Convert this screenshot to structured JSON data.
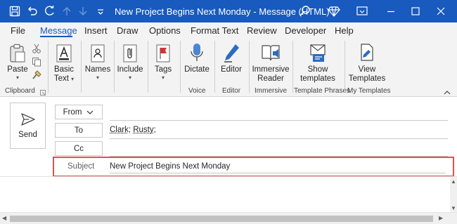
{
  "window": {
    "title": "New Project Begins Next Monday  -  Message (HTML)",
    "accent_color": "#185abd",
    "highlight_color": "#e0524b"
  },
  "titlebar_icons": [
    "save-icon",
    "undo-icon",
    "redo-icon",
    "up-arrow-icon",
    "down-arrow-icon",
    "customize-qat-icon",
    "search-icon",
    "diamond-icon",
    "restore-icon",
    "minimize-icon",
    "maximize-icon",
    "close-icon"
  ],
  "menu": {
    "tabs": [
      "File",
      "Message",
      "Insert",
      "Draw",
      "Options",
      "Format Text",
      "Review",
      "Developer",
      "Help"
    ],
    "active": "Message"
  },
  "ribbon": {
    "paste": "Paste",
    "basic_text": [
      "Basic",
      "Text"
    ],
    "names": "Names",
    "include": "Include",
    "tags": "Tags",
    "dictate": "Dictate",
    "editor": "Editor",
    "immersive_reader": [
      "Immersive",
      "Reader"
    ],
    "show_templates": [
      "Show",
      "templates"
    ],
    "view_templates": [
      "View",
      "Templates"
    ],
    "groups": [
      "Clipboard",
      "Voice",
      "Editor",
      "Immersive",
      "Template Phrases",
      "My Templates"
    ]
  },
  "compose": {
    "send": "Send",
    "from_label": "From",
    "to_label": "To",
    "to_value": [
      "Clark",
      "Rusty"
    ],
    "cc_label": "Cc",
    "subject_label": "Subject",
    "subject_value": "New Project Begins Next Monday"
  }
}
